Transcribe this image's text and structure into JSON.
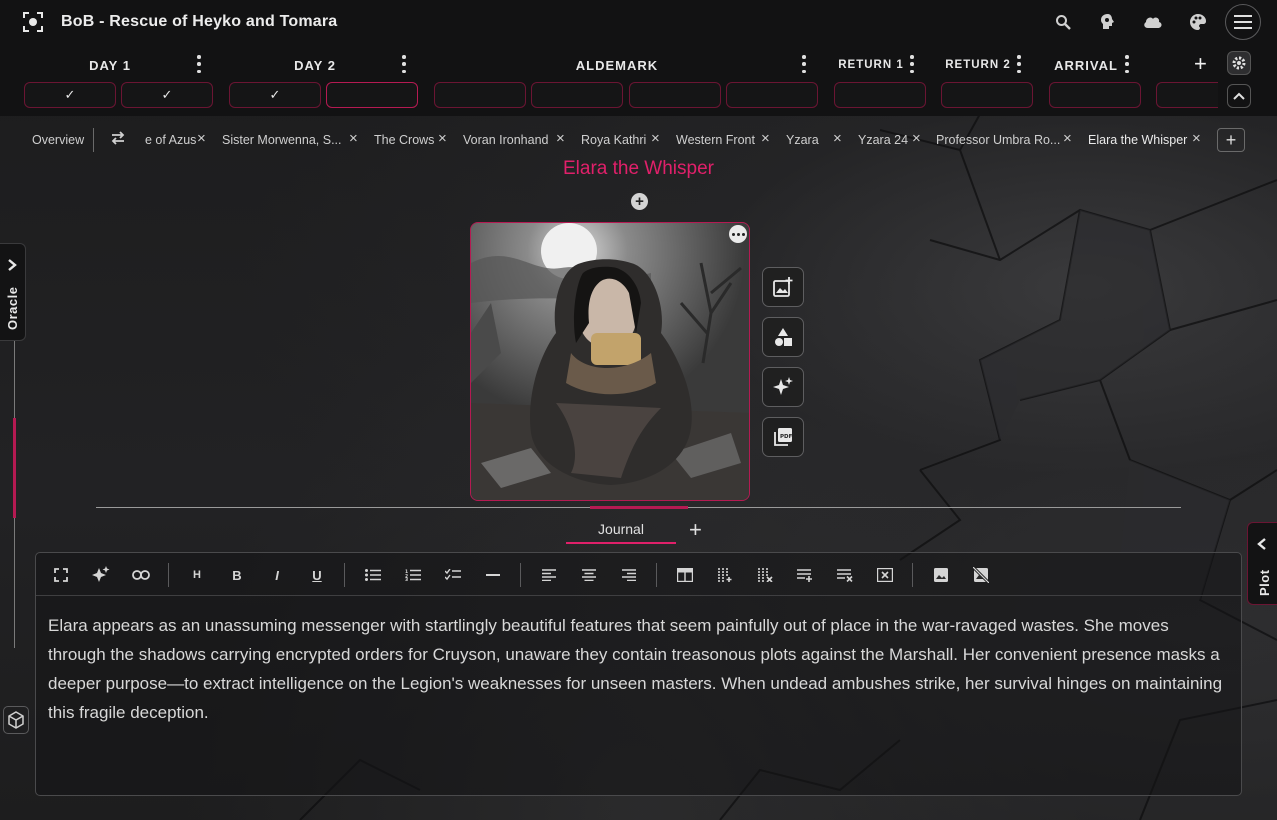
{
  "app": {
    "title": "BoB - Rescue of Heyko and Tomara",
    "icons": [
      "focus-icon",
      "search-icon",
      "brain-icon",
      "cloud-icon",
      "palette-icon",
      "menu-icon"
    ]
  },
  "sessions": [
    {
      "label": "DAY 1",
      "slots": [
        "✓",
        "✓"
      ]
    },
    {
      "label": "DAY 2",
      "slots": [
        "✓",
        ""
      ]
    },
    {
      "label": "ALDEMARK",
      "slots": [
        "",
        "",
        "",
        ""
      ]
    },
    {
      "label": "RETURN 1",
      "slots": [
        ""
      ]
    },
    {
      "label": "RETURN 2",
      "slots": [
        ""
      ]
    },
    {
      "label": "ARRIVAL",
      "slots": [
        ""
      ]
    }
  ],
  "tabs": {
    "overview": "Overview",
    "items": [
      "e of Azus",
      "Sister Morwenna, S...",
      "The Crows",
      "Voran Ironhand",
      "Roya Kathri",
      "Western Front",
      "Yzara",
      "Yzara 24",
      "Professor Umbra Ro...",
      "Elara the Whisper"
    ],
    "add_label": "+"
  },
  "entity": {
    "name": "Elara the Whisper",
    "image_alt": "Hooded woman clutching scroll in moonlit ruins"
  },
  "side_tools": [
    "add-image-icon",
    "shapes-icon",
    "sparkle-icon",
    "pdf-icon"
  ],
  "left_rail": {
    "label": "Oracle"
  },
  "right_rail": {
    "label": "Plot"
  },
  "journal": {
    "tab_label": "Journal",
    "add_label": "+",
    "text": "Elara appears as an unassuming messenger with startlingly beautiful features that seem painfully out of place in the war-ravaged wastes. She moves through the shadows carrying encrypted orders for Cruyson, unaware they contain treasonous plots against the Marshall. Her convenient presence masks a deeper purpose—to extract intelligence on the Legion's weaknesses for unseen masters. When undead ambushes strike, her survival hinges on maintaining this fragile deception."
  },
  "toolbar": {
    "heading_label": "H",
    "bold_label": "B",
    "italic_label": "I",
    "underline_label": "U"
  },
  "colors": {
    "accent": "#e0206a",
    "accent_dark": "#b51a52",
    "background": "#1f1f20",
    "bar": "#121213"
  }
}
